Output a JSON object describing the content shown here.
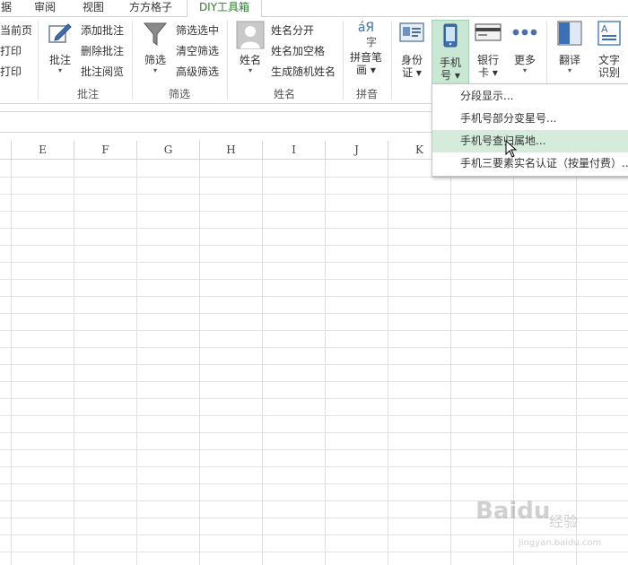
{
  "tabs": [
    "据",
    "审阅",
    "视图",
    "方方格子",
    "DIY工具箱"
  ],
  "active_tab": "DIY工具箱",
  "print_group": {
    "items": [
      "当前页",
      "打印",
      "打印"
    ]
  },
  "comment_group": {
    "big_label": "批注",
    "items": [
      "添加批注",
      "删除批注",
      "批注阅览"
    ],
    "label": "批注"
  },
  "filter_group": {
    "big_label": "筛选",
    "items": [
      "筛选选中",
      "清空筛选",
      "高级筛选"
    ],
    "label": "筛选"
  },
  "name_group": {
    "big_label": "姓名",
    "items": [
      "姓名分开",
      "姓名加空格",
      "生成随机姓名"
    ],
    "label": "姓名"
  },
  "pinyin_group": {
    "big_label_line1": "拼音笔",
    "big_label_line2": "画",
    "label": "拼音",
    "icon_text_top": "áЯ",
    "icon_text_bottom": "字"
  },
  "buttons": {
    "idcard_line1": "身份",
    "idcard_line2": "证",
    "phone_line1": "手机",
    "phone_line2": "号",
    "bankcard_line1": "银行",
    "bankcard_line2": "卡",
    "more": "更多",
    "translate": "翻译",
    "ocr_line1": "文字",
    "ocr_line2": "识别"
  },
  "columns": [
    "E",
    "F",
    "G",
    "H",
    "I",
    "J",
    "K"
  ],
  "dropdown": {
    "items": [
      "分段显示...",
      "手机号部分变星号...",
      "手机号查归属地...",
      "手机三要素实名认证（按量付费）..."
    ],
    "highlighted_index": 2
  },
  "watermark": {
    "brand": "Baidu",
    "suffix": "经验",
    "url": "jingyan.baidu.com"
  },
  "colors": {
    "accent": "#2e7d32",
    "highlight": "#d5ecdc",
    "active_button": "#c9e8d3"
  }
}
